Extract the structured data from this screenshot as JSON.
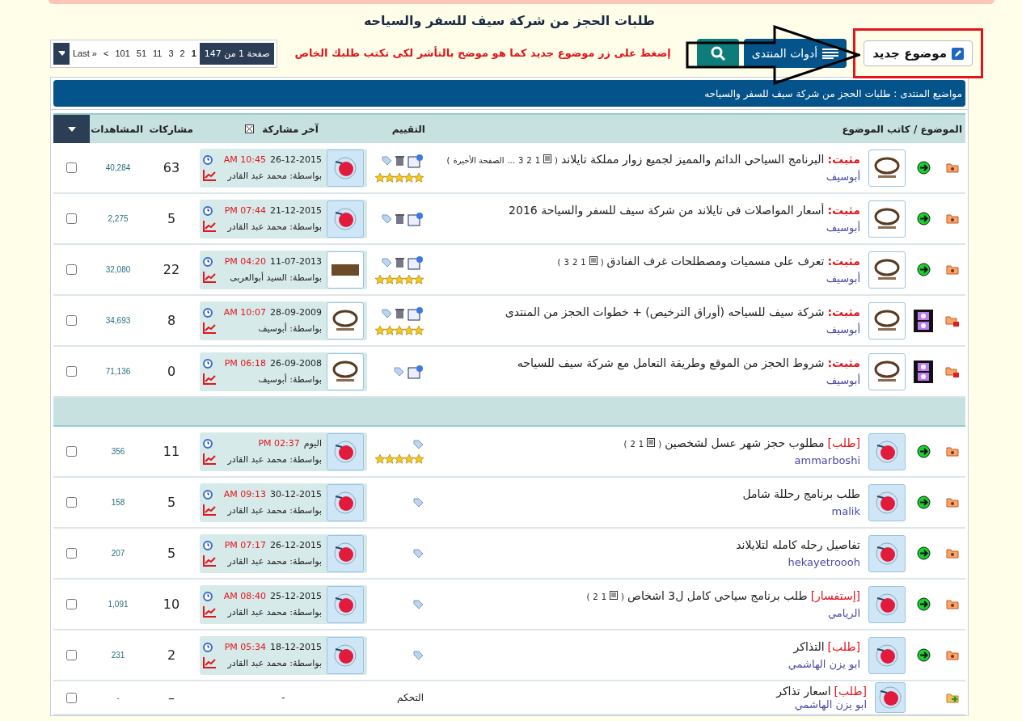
{
  "forum_title": "طلبات الحجز من شركة سيف للسفر والسياحه",
  "toolbar": {
    "new_topic": "موضوع جديد",
    "forum_tools": "أدوات المنتدى",
    "instruction": "إضغط على زر موضوع جديد كما هو موضح بالتأشر لكى تكتب طلبك الخاص"
  },
  "pagination": {
    "label": "صفحة 1 من 147",
    "pages": [
      {
        "label": "1",
        "selected": true
      },
      {
        "label": "2",
        "selected": false
      },
      {
        "label": "3",
        "selected": false
      },
      {
        "label": "11",
        "selected": false
      },
      {
        "label": "51",
        "selected": false
      },
      {
        "label": "101",
        "selected": false
      },
      {
        "label": "<",
        "selected": false
      },
      {
        "label": "Last »",
        "selected": false
      }
    ]
  },
  "breadcrumb": "مواضيع المنتدى : طلبات الحجز من شركة سيف للسفر والسياحه",
  "columns": {
    "topic": "الموضوع / كاتب الموضوع",
    "rating": "التقييم",
    "last_post": "آخر مشاركة",
    "replies": "مشاركات",
    "views": "المشاهدات"
  },
  "sticky_threads": [
    {
      "status": {
        "kind": "arrow"
      },
      "folder": {
        "kind": "normal"
      },
      "prefix": "مثبت:",
      "title": "البرنامج السياحى الدائم والمميز لجميع زوار مملكة تايلاند",
      "page_links": {
        "open": "(",
        "pages": [
          "1",
          "2",
          "3"
        ],
        "more": "...",
        "last": "الصفحة الأخيرة",
        "close": ")"
      },
      "author": "أبوسيف",
      "avatar": {
        "kind": "est"
      },
      "icons": [
        {
          "kind": "edit"
        },
        {
          "kind": "trash"
        },
        {
          "kind": "tag"
        }
      ],
      "stars": 5,
      "last_post": {
        "date": "26-12-2015",
        "time": "AM 10:45",
        "by": "بواسطة: محمد عبد القادر",
        "avatar": {
          "kind": "elephant"
        }
      },
      "replies": "63",
      "views": "40,284",
      "checked": false
    },
    {
      "status": {
        "kind": "arrow"
      },
      "folder": {
        "kind": "normal"
      },
      "prefix": "مثبت:",
      "title": "أسعار المواصلات فى تايلاند من شركة سيف للسفر والسياحة 2016",
      "author": "أبوسيف",
      "avatar": {
        "kind": "est"
      },
      "icons": [
        {
          "kind": "edit"
        },
        {
          "kind": "trash"
        },
        {
          "kind": "tag"
        }
      ],
      "last_post": {
        "date": "21-12-2015",
        "time": "PM 07:44",
        "by": "بواسطة: محمد عبد القادر",
        "avatar": {
          "kind": "elephant"
        }
      },
      "replies": "5",
      "views": "2,275",
      "checked": false
    },
    {
      "status": {
        "kind": "arrow"
      },
      "folder": {
        "kind": "normal"
      },
      "prefix": "مثبت:",
      "title": "تعرف على مسميات ومصطلحات غرف الفنادق",
      "page_links": {
        "open": "(",
        "pages": [
          "1",
          "2",
          "3"
        ],
        "close": ")"
      },
      "author": "أبوسيف",
      "avatar": {
        "kind": "est"
      },
      "icons": [
        {
          "kind": "edit"
        },
        {
          "kind": "trash"
        },
        {
          "kind": "tag"
        }
      ],
      "stars": 5,
      "last_post": {
        "date": "11-07-2013",
        "time": "PM 04:20",
        "by": "بواسطة: السيد أبوالعربى",
        "avatar": {
          "kind": "photo"
        }
      },
      "replies": "22",
      "views": "32,080",
      "checked": false
    },
    {
      "status": {
        "kind": "film"
      },
      "folder": {
        "kind": "locked"
      },
      "prefix": "مثبت:",
      "title": "شركة سيف للسياحه (أوراق الترخيص) + خطوات الحجز من المنتدى",
      "author": "أبوسيف",
      "avatar": {
        "kind": "est"
      },
      "icons": [
        {
          "kind": "edit"
        },
        {
          "kind": "trash"
        },
        {
          "kind": "tag"
        }
      ],
      "stars": 5,
      "last_post": {
        "date": "28-09-2009",
        "time": "AM 10:07",
        "by": "بواسطة: أبوسيف",
        "avatar": {
          "kind": "est"
        }
      },
      "replies": "8",
      "views": "34,693",
      "checked": false
    },
    {
      "status": {
        "kind": "film"
      },
      "folder": {
        "kind": "locked"
      },
      "prefix": "مثبت:",
      "title": "شروط الحجز من الموقع وطريقة التعامل مع شركة سيف للسياحه",
      "author": "أبوسيف",
      "avatar": {
        "kind": "est"
      },
      "icons": [
        {
          "kind": "edit"
        },
        {
          "kind": "tag"
        }
      ],
      "last_post": {
        "date": "26-09-2008",
        "time": "PM 06:18",
        "by": "بواسطة: أبوسيف",
        "avatar": {
          "kind": "est"
        }
      },
      "replies": "0",
      "views": "71,136",
      "checked": false
    }
  ],
  "threads": [
    {
      "status": {
        "kind": "arrow"
      },
      "folder": {
        "kind": "normal"
      },
      "prefix": "[طلب]",
      "title": "مطلوب حجز شهر عسل لشخصين",
      "page_links": {
        "open": "(",
        "pages": [
          "1",
          "2"
        ],
        "close": ")"
      },
      "author": "ammarboshi",
      "avatar": {
        "kind": "elephant"
      },
      "icons": [
        {
          "kind": "tag"
        }
      ],
      "stars": 5,
      "last_post": {
        "date": "اليوم",
        "time": "PM 02:37",
        "by": "بواسطة: محمد عبد القادر",
        "avatar": {
          "kind": "elephant"
        }
      },
      "replies": "11",
      "views": "356",
      "checked": false
    },
    {
      "status": {
        "kind": "arrow"
      },
      "folder": {
        "kind": "normal"
      },
      "title": "طلب برنامج رحللة شامل",
      "author": "malik",
      "avatar": {
        "kind": "elephant"
      },
      "icons": [
        {
          "kind": "tag"
        }
      ],
      "last_post": {
        "date": "30-12-2015",
        "time": "AM 09:13",
        "by": "بواسطة: محمد عبد القادر",
        "avatar": {
          "kind": "elephant"
        }
      },
      "replies": "5",
      "views": "158",
      "checked": false
    },
    {
      "status": {
        "kind": "arrow"
      },
      "folder": {
        "kind": "normal"
      },
      "title": "تفاصيل رحله كامله لتلايلاند",
      "author": "hekayetroooh",
      "avatar": {
        "kind": "elephant"
      },
      "icons": [
        {
          "kind": "tag"
        }
      ],
      "last_post": {
        "date": "26-12-2015",
        "time": "PM 07:17",
        "by": "بواسطة: محمد عبد القادر",
        "avatar": {
          "kind": "elephant"
        }
      },
      "replies": "5",
      "views": "207",
      "checked": false
    },
    {
      "status": {
        "kind": "arrow"
      },
      "folder": {
        "kind": "normal"
      },
      "prefix": "[إستفسار]",
      "title": "طلب برنامج سياحي كامل ل3 اشخاص",
      "page_links": {
        "open": "(",
        "pages": [
          "1",
          "2"
        ],
        "close": ")"
      },
      "author": "الريامي",
      "avatar": {
        "kind": "elephant"
      },
      "icons": [
        {
          "kind": "tag"
        }
      ],
      "last_post": {
        "date": "25-12-2015",
        "time": "AM 08:40",
        "by": "بواسطة: محمد عبد القادر",
        "avatar": {
          "kind": "elephant"
        }
      },
      "replies": "10",
      "views": "1,091",
      "checked": false
    },
    {
      "status": {
        "kind": "arrow"
      },
      "folder": {
        "kind": "normal"
      },
      "prefix": "[طلب]",
      "title": "التذاكر",
      "author": "ابو يزن الهاشمي",
      "avatar": {
        "kind": "elephant"
      },
      "icons": [
        {
          "kind": "tag"
        }
      ],
      "last_post": {
        "date": "18-12-2015",
        "time": "PM 05:34",
        "by": "بواسطة: محمد عبد القادر",
        "avatar": {
          "kind": "elephant"
        }
      },
      "replies": "2",
      "views": "231",
      "checked": false
    },
    {
      "kind": "moved",
      "folder": {
        "kind": "moved"
      },
      "prefix": "[طلب]",
      "title": "اسعار تذاكر",
      "author": "ابو يزن الهاشمي",
      "avatar": {
        "kind": "elephant"
      },
      "rating_text": "التحكم",
      "last_post_text": "-",
      "replies": "–",
      "views": "-",
      "checked": false
    }
  ]
}
